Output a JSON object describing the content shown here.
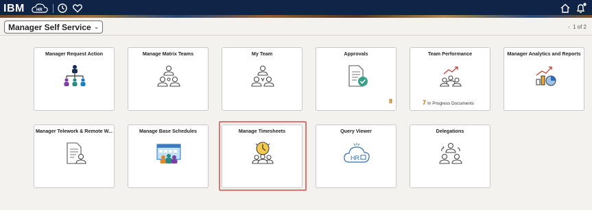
{
  "banner": {
    "logo": "IBM",
    "icons": [
      "hr-cloud-icon",
      "clock-icon",
      "heart-icon",
      "home-icon",
      "bell-icon"
    ]
  },
  "header": {
    "page_select": "Manager Self Service",
    "pager": "1 of 2"
  },
  "tiles": [
    {
      "title": "Manager Request Action",
      "icon": "org-chart-icon"
    },
    {
      "title": "Manage Matrix Teams",
      "icon": "matrix-team-icon"
    },
    {
      "title": "My Team",
      "icon": "team-icon"
    },
    {
      "title": "Approvals",
      "icon": "approval-document-icon",
      "count": "8"
    },
    {
      "title": "Team Performance",
      "icon": "performance-chart-icon",
      "progress_count": "7",
      "progress_label": "In Progress Documents"
    },
    {
      "title": "Manager Analytics and Reports",
      "icon": "analytics-chart-icon"
    },
    {
      "title": "Manager Telework & Remote W...",
      "icon": "telework-document-icon"
    },
    {
      "title": "Manage Base Schedules",
      "icon": "calendar-team-icon"
    },
    {
      "title": "Manage Timesheets",
      "icon": "clock-team-icon"
    },
    {
      "title": "Query Viewer",
      "icon": "hr-cloud-query-icon"
    },
    {
      "title": "Delegations",
      "icon": "delegation-icon"
    }
  ],
  "colors": {
    "banner": "#0f2447",
    "accent_count": "#b36b00",
    "highlight": "#e07272"
  }
}
